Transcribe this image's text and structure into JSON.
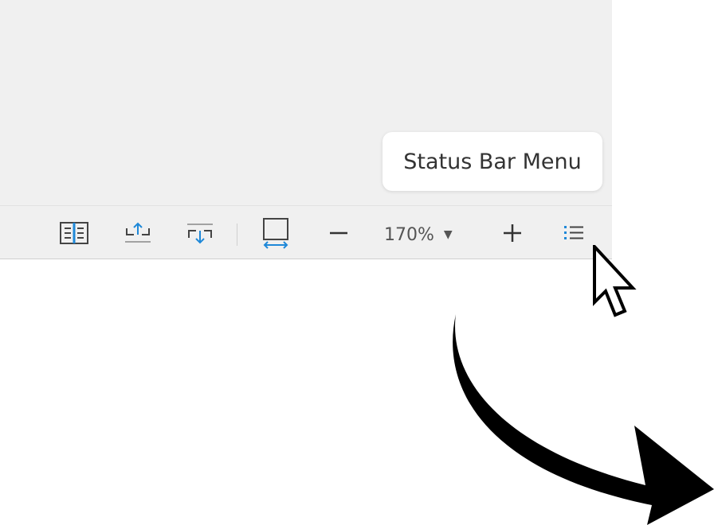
{
  "tooltip": {
    "text": "Status Bar Menu"
  },
  "status_bar": {
    "icons": {
      "read_mode": "read-mode-icon",
      "scroll_up": "page-scroll-up-icon",
      "scroll_down": "page-scroll-down-icon",
      "fit_width": "fit-width-icon",
      "zoom_out": "zoom-out-icon",
      "zoom_in": "zoom-in-icon",
      "menu": "status-bar-menu-icon"
    },
    "zoom_level": "170%",
    "zoom_dropdown_glyph": "▼"
  },
  "colors": {
    "accent": "#1e88d8",
    "background": "#f0f0f0",
    "icon": "#444444",
    "tooltip_bg": "#ffffff"
  }
}
